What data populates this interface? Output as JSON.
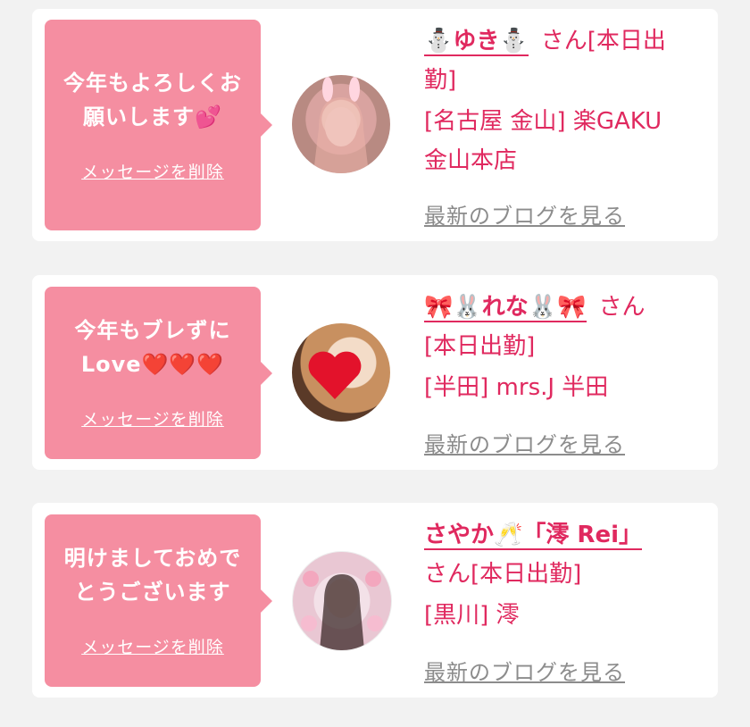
{
  "cards": [
    {
      "message_line1": "今年もよろしくお",
      "message_line2": "願いします💕",
      "delete_label": "メッセージを削除",
      "name": "⛄ゆき⛄",
      "san": "さん[本日出",
      "line1": "勤]",
      "line2": "[名古屋 金山] 楽GAKU",
      "line3": "金山本店",
      "blog_label": "最新のブログを見る",
      "avatar_icon": "avatar-photo-bunny-ears"
    },
    {
      "message_line1": "今年もブレずに",
      "message_line2": "Love❤️❤️❤️",
      "delete_label": "メッセージを削除",
      "name": "🎀🐰れな🐰🎀",
      "san": "さん",
      "line1": "[本日出勤]",
      "line2": "[半田] mrs.J 半田",
      "blog_label": "最新のブログを見る",
      "avatar_icon": "avatar-photo-heart"
    },
    {
      "message_line1": "明けましておめで",
      "message_line2": "とうございます",
      "delete_label": "メッセージを削除",
      "name": "さやか🥂「澪 Rei」",
      "line1": "さん[本日出勤]",
      "line2": "[黒川] 澪",
      "blog_label": "最新のブログを見る",
      "avatar_icon": "avatar-photo-flowers"
    }
  ],
  "colors": {
    "accent": "#e0295f",
    "bubble": "#f58ea1",
    "link_gray": "#8c8c8c",
    "background": "#f2f2f2"
  }
}
